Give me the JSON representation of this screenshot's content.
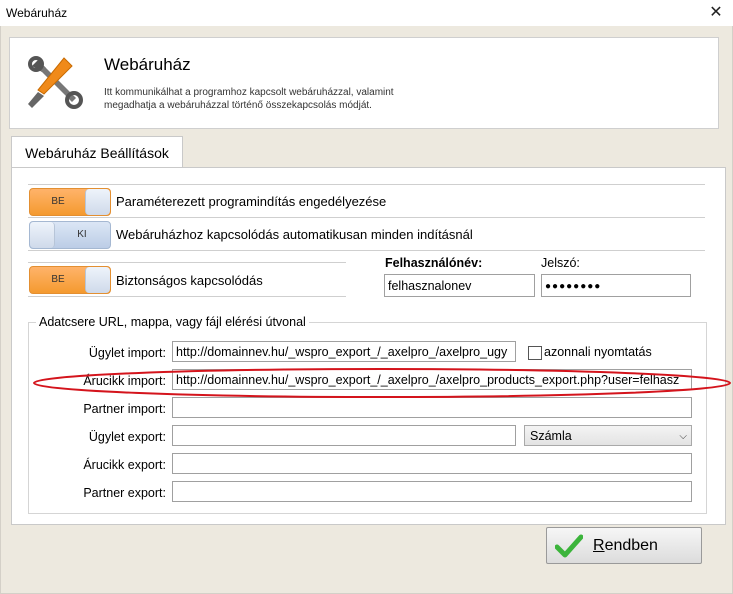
{
  "window": {
    "title": "Webáruház",
    "close_glyph": "✕"
  },
  "header": {
    "icon": "wrench-screwdriver-icon",
    "title": "Webáruház",
    "description": "Itt kommunikálhat a programhoz kapcsolt webáruházzal, valamint megadhatja a webáruházzal történő összekapcsolás módját."
  },
  "tabs": [
    {
      "label": "Webáruház Beállítások"
    }
  ],
  "toggles": [
    {
      "state": "BE",
      "label": "Paraméterezett programindítás engedélyezése"
    },
    {
      "state": "KI",
      "label": "Webáruházhoz kapcsolódás automatikusan minden indításnál"
    },
    {
      "state": "BE",
      "label": "Biztonságos kapcsolódás"
    }
  ],
  "credentials": {
    "username_label": "Felhasználónév:",
    "username_value": "felhasznalonev",
    "password_label": "Jelszó:",
    "password_value": "●●●●●●●●"
  },
  "data_exchange": {
    "group_title": "Adatcsere URL, mappa, vagy fájl elérési útvonal",
    "rows": [
      {
        "label": "Ügylet import:",
        "value": "http://domainnev.hu/_wspro_export_/_axelpro_/axelpro_ugy"
      },
      {
        "label": "Árucikk import:",
        "value": "http://domainnev.hu/_wspro_export_/_axelpro_/axelpro_products_export.php?user=felhasz"
      },
      {
        "label": "Partner import:",
        "value": ""
      },
      {
        "label": "Ügylet export:",
        "value": ""
      },
      {
        "label": "Árucikk export:",
        "value": ""
      },
      {
        "label": "Partner export:",
        "value": ""
      }
    ],
    "immediate_print_label": "azonnali nyomtatás",
    "export_type_selected": "Számla"
  },
  "ok_button": {
    "label_first": "R",
    "label_rest": "endben",
    "icon": "checkmark-icon"
  },
  "highlight_color": "#d4141c"
}
